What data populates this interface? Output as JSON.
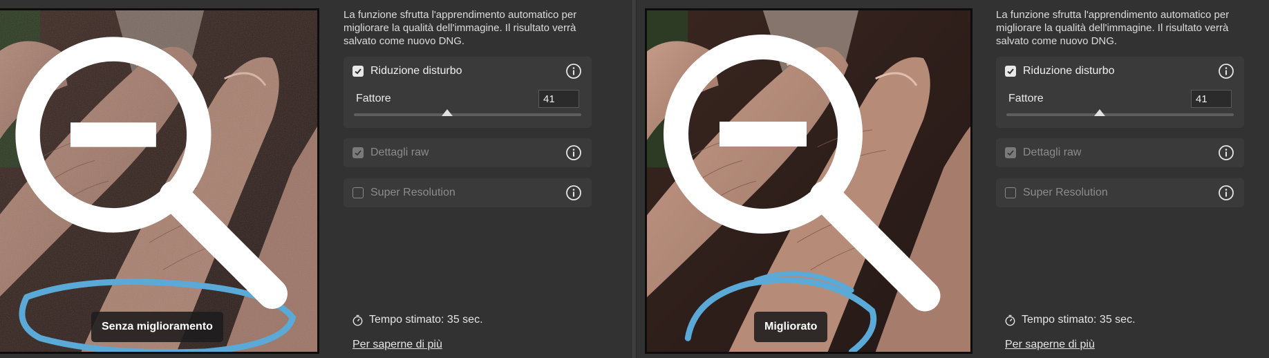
{
  "description": "La funzione sfrutta l'apprendimento automatico per migliorare la qualità dell'immagine. Il risultato verrà salvato come nuovo DNG.",
  "panels": [
    {
      "badge": "Senza miglioramento",
      "noise_reduction": {
        "label": "Riduzione disturbo",
        "checked": true
      },
      "factor": {
        "label": "Fattore",
        "value": "41",
        "slider_fraction": 0.41
      },
      "raw_details": {
        "label": "Dettagli raw",
        "checked": true,
        "enabled": false
      },
      "super_resolution": {
        "label": "Super Resolution",
        "checked": false,
        "enabled": false
      },
      "estimated_time": "Tempo stimato: 35 sec.",
      "learn_more": "Per saperne di più"
    },
    {
      "badge": "Migliorato",
      "noise_reduction": {
        "label": "Riduzione disturbo",
        "checked": true
      },
      "factor": {
        "label": "Fattore",
        "value": "41",
        "slider_fraction": 0.41
      },
      "raw_details": {
        "label": "Dettagli raw",
        "checked": true,
        "enabled": false
      },
      "super_resolution": {
        "label": "Super Resolution",
        "checked": false,
        "enabled": false
      },
      "estimated_time": "Tempo stimato: 35 sec.",
      "learn_more": "Per saperne di più"
    }
  ],
  "icons": {
    "checkmark": "checkmark-icon",
    "info": "info-icon",
    "zoom_out": "zoom-out-icon",
    "timer": "stopwatch-icon"
  },
  "colors": {
    "background": "#323232",
    "card": "#3a3a3a",
    "annotation_stroke": "#5aa9d6"
  }
}
